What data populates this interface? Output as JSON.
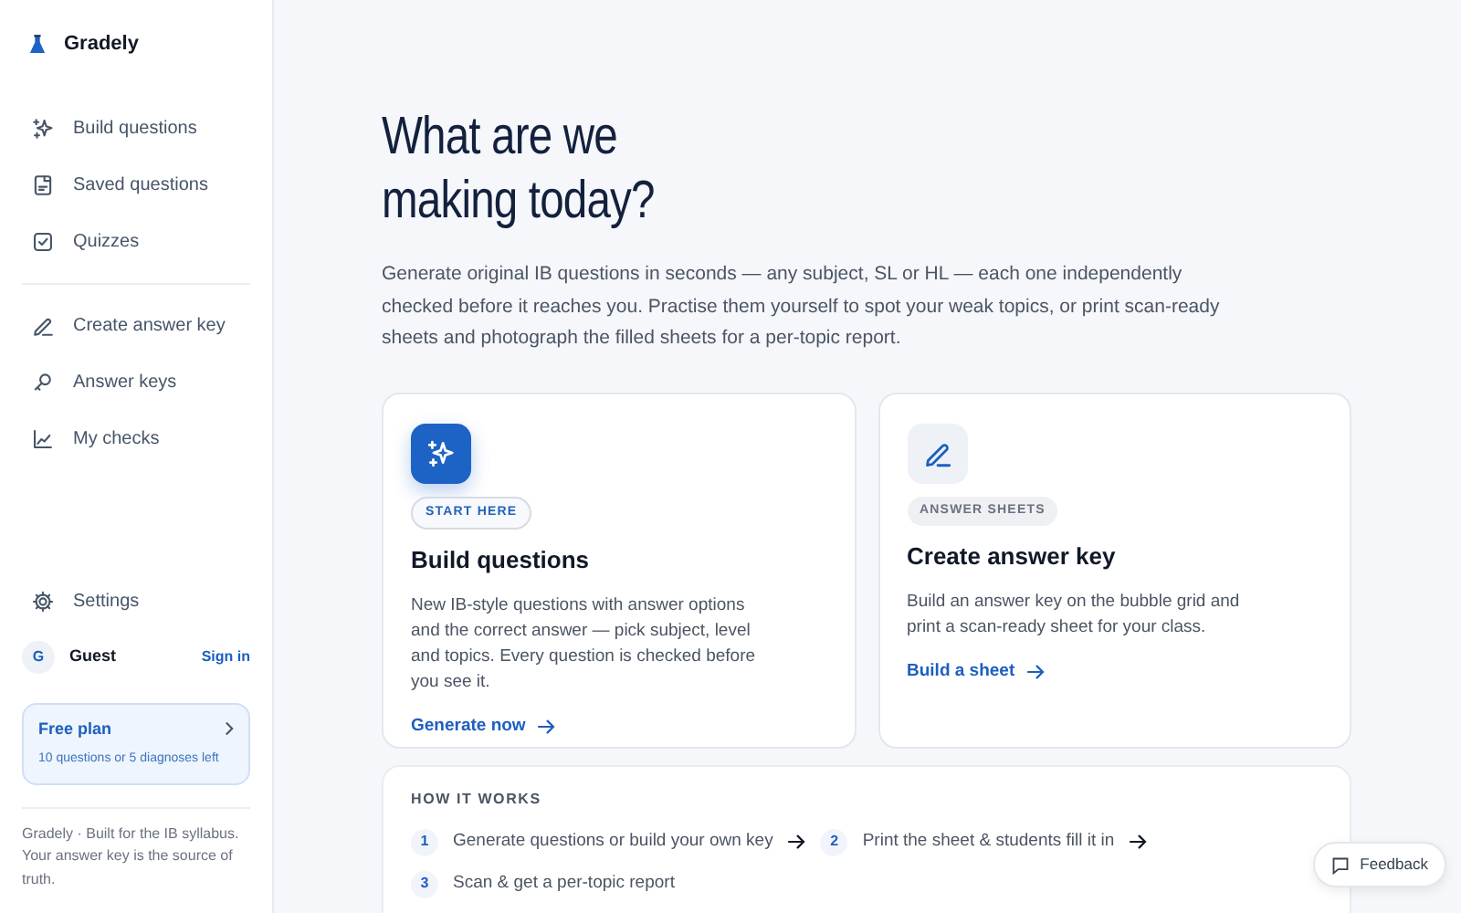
{
  "brand": {
    "name": "Gradely"
  },
  "nav_groups": [
    [
      {
        "label": "Build questions",
        "selected": false
      },
      {
        "label": "Saved questions",
        "selected": false
      },
      {
        "label": "Quizzes",
        "selected": false
      }
    ],
    [
      {
        "label": "Create answer key",
        "selected": false
      },
      {
        "label": "Answer keys",
        "selected": false
      },
      {
        "label": "My checks",
        "selected": false
      }
    ]
  ],
  "settings": {
    "label": "Settings"
  },
  "user": {
    "initial": "G",
    "name": "Guest",
    "action": "Sign in"
  },
  "plan": {
    "title": "Free plan",
    "detail": "10 questions or 5 diagnoses left"
  },
  "footer_note": "Gradely · Built for the IB syllabus. Your answer key is the source of truth.",
  "heading": [
    "What are we",
    "making today?"
  ],
  "intro": "Generate original IB questions in seconds — any subject, SL or HL — each one independently checked before it reaches you. Practise them yourself to spot your weak topics, or print scan-ready sheets and photograph the filled sheets for a per-topic report.",
  "cards": [
    {
      "featured": true,
      "tag": "START HERE",
      "title": "Build questions",
      "text": "New IB-style questions with answer options and the correct answer — pick subject, level and topics. Every question is checked before you see it.",
      "link": "Generate now"
    },
    {
      "featured": false,
      "tag": "ANSWER SHEETS",
      "title": "Create answer key",
      "text": "Build an answer key on the bubble grid and print a scan-ready sheet for your class.",
      "link": "Build a sheet"
    }
  ],
  "how_it_works": {
    "title": "HOW IT WORKS",
    "steps": [
      {
        "number": "1",
        "text": "Generate questions or build your own key",
        "arrow": true
      },
      {
        "number": "2",
        "text": "Print the sheet & students fill it in",
        "arrow": true
      },
      {
        "number": "3",
        "text": "Scan & get a per-topic report",
        "arrow": false
      }
    ]
  },
  "feedback": {
    "label": "Feedback"
  }
}
